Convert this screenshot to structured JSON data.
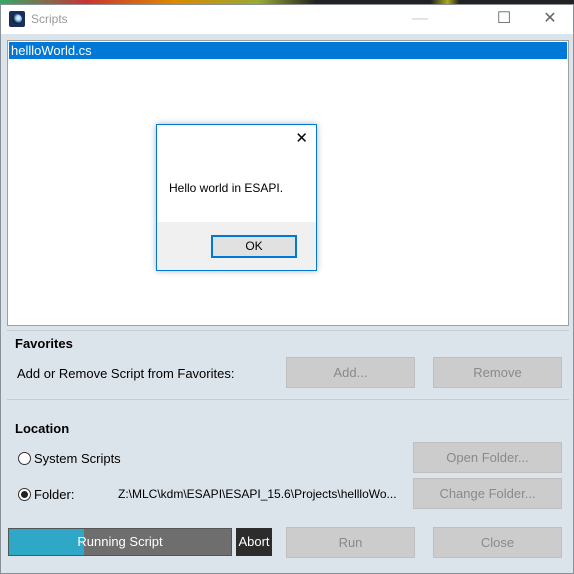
{
  "window": {
    "title": "Scripts",
    "minimize": "—",
    "maximize": "☐",
    "close": "✕"
  },
  "scripts": [
    {
      "name": "hellloWorld.cs",
      "selected": true
    }
  ],
  "favorites": {
    "heading": "Favorites",
    "description": "Add or Remove Script from Favorites:",
    "add": "Add...",
    "remove": "Remove"
  },
  "location": {
    "heading": "Location",
    "system_scripts": "System Scripts",
    "folder_label": "Folder:",
    "folder_path": "Z:\\MLC\\kdm\\ESAPI\\ESAPI_15.6\\Projects\\hellloWo...",
    "open_folder": "Open Folder...",
    "change_folder": "Change Folder...",
    "selected": "folder"
  },
  "footer": {
    "progress_label": "Running Script",
    "progress_percent": 34,
    "abort": "Abort",
    "run": "Run",
    "close": "Close"
  },
  "dialog": {
    "message": "Hello world in ESAPI.",
    "ok": "OK",
    "close": "✕"
  }
}
